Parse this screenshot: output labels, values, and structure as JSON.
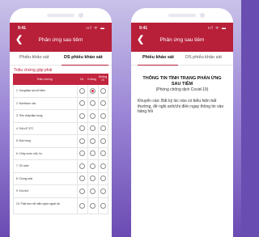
{
  "status": {
    "time": "9:41",
    "icons": "ııl ᯤ ▬"
  },
  "header": {
    "title": "Phản ứng sau tiêm",
    "back_glyph": "❮"
  },
  "tabs": [
    "Phiếu khảo sát",
    "DS phiếu khảo sát"
  ],
  "left_phone": {
    "section_title": "Triệu chứng gặp phải",
    "columns": [
      "Triệu chứng",
      "Có",
      "Không",
      "Không rõ"
    ],
    "rows": [
      {
        "label": "1. Sưng/đau tại chỗ tiêm",
        "selected": 2
      },
      {
        "label": "2. Nôn/buồn nôn",
        "selected": 0
      },
      {
        "label": "3. Tiêu chảy/đau bụng",
        "selected": 0
      },
      {
        "label": "4. Sốt ≥37.5°C",
        "selected": 0
      },
      {
        "label": "5. Đau họng",
        "selected": 0
      },
      {
        "label": "6. Chảy nước mũi, ho",
        "selected": 0
      },
      {
        "label": "7. Ớn lạnh",
        "selected": 0
      },
      {
        "label": "8. Chóng mặt",
        "selected": 0
      },
      {
        "label": "9. Khó thở",
        "selected": 0
      },
      {
        "label": "10. Phát ban nổi mẩn ngứa ngoài da",
        "selected": 0
      }
    ]
  },
  "right_phone": {
    "title": "THÔNG TIN TÌNH TRẠNG PHẢN ỨNG SAU TIÊM",
    "subtitle": "(Phòng chống dịch Covid-19)",
    "text": "Khuyến cáo: Bất kỳ lúc nào có biểu hiện bất thường, đề nghị anh/chị điền ngay thông tin vào bảng hỏi"
  },
  "colors": {
    "accent": "#b8203a",
    "radio_selected": "#e0283f",
    "background": "#6b4bb3"
  }
}
